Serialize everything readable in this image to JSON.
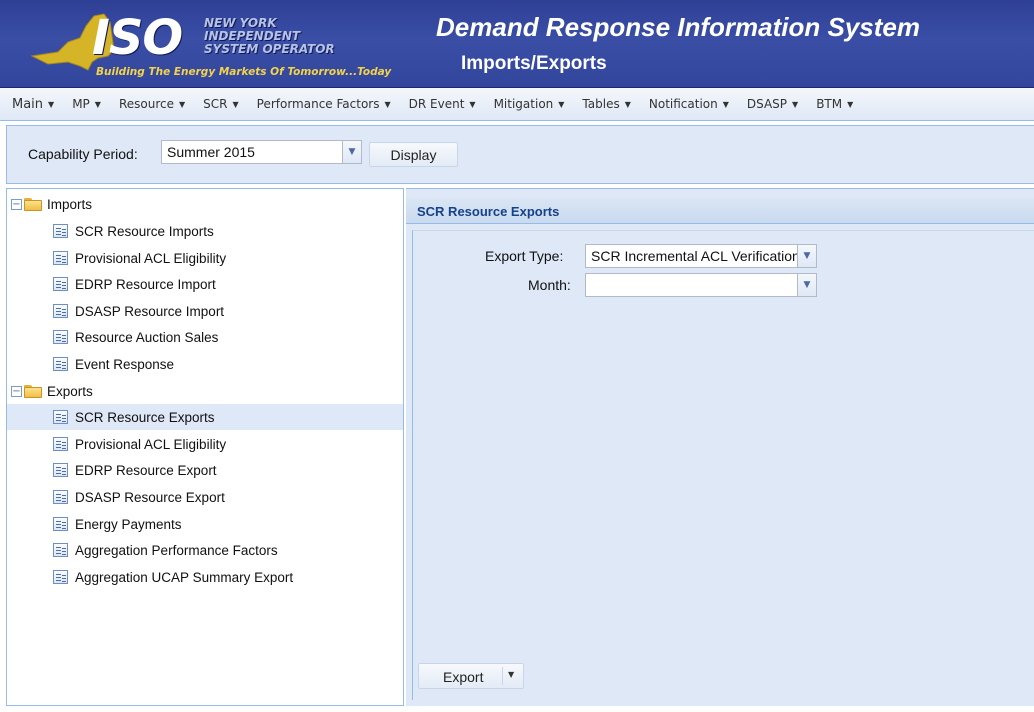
{
  "header": {
    "logo_text": "ISO",
    "logo_name_lines": [
      "NEW YORK",
      "INDEPENDENT",
      "SYSTEM OPERATOR"
    ],
    "logo_tagline": "Building The Energy Markets Of Tomorrow...Today",
    "app_title": "Demand Response Information System",
    "page_title": "Imports/Exports"
  },
  "menu": [
    {
      "label": "Main"
    },
    {
      "label": "MP"
    },
    {
      "label": "Resource"
    },
    {
      "label": "SCR"
    },
    {
      "label": "Performance Factors"
    },
    {
      "label": "DR Event"
    },
    {
      "label": "Mitigation"
    },
    {
      "label": "Tables"
    },
    {
      "label": "Notification"
    },
    {
      "label": "DSASP"
    },
    {
      "label": "BTM"
    }
  ],
  "toolbar": {
    "capability_label": "Capability Period:",
    "capability_value": "Summer 2015",
    "display_button": "Display"
  },
  "tree": {
    "imports": {
      "label": "Imports",
      "items": [
        "SCR Resource Imports",
        "Provisional ACL Eligibility",
        "EDRP Resource Import",
        "DSASP Resource Import",
        "Resource Auction Sales",
        "Event Response"
      ]
    },
    "exports": {
      "label": "Exports",
      "items": [
        "SCR Resource Exports",
        "Provisional ACL Eligibility",
        "EDRP Resource Export",
        "DSASP Resource Export",
        "Energy Payments",
        "Aggregation Performance Factors",
        "Aggregation UCAP Summary Export"
      ],
      "selected": "SCR Resource Exports"
    }
  },
  "main": {
    "title": "SCR Resource Exports",
    "export_type_label": "Export Type:",
    "export_type_value": "SCR Incremental ACL Verification",
    "month_label": "Month:",
    "month_value": "",
    "export_button": "Export"
  },
  "colors": {
    "header_bg": "#3a4ea6",
    "panel_bg": "#dfe8f6",
    "border": "#99bbe8",
    "title_text": "#15428b",
    "tagline": "#f4d34a"
  }
}
